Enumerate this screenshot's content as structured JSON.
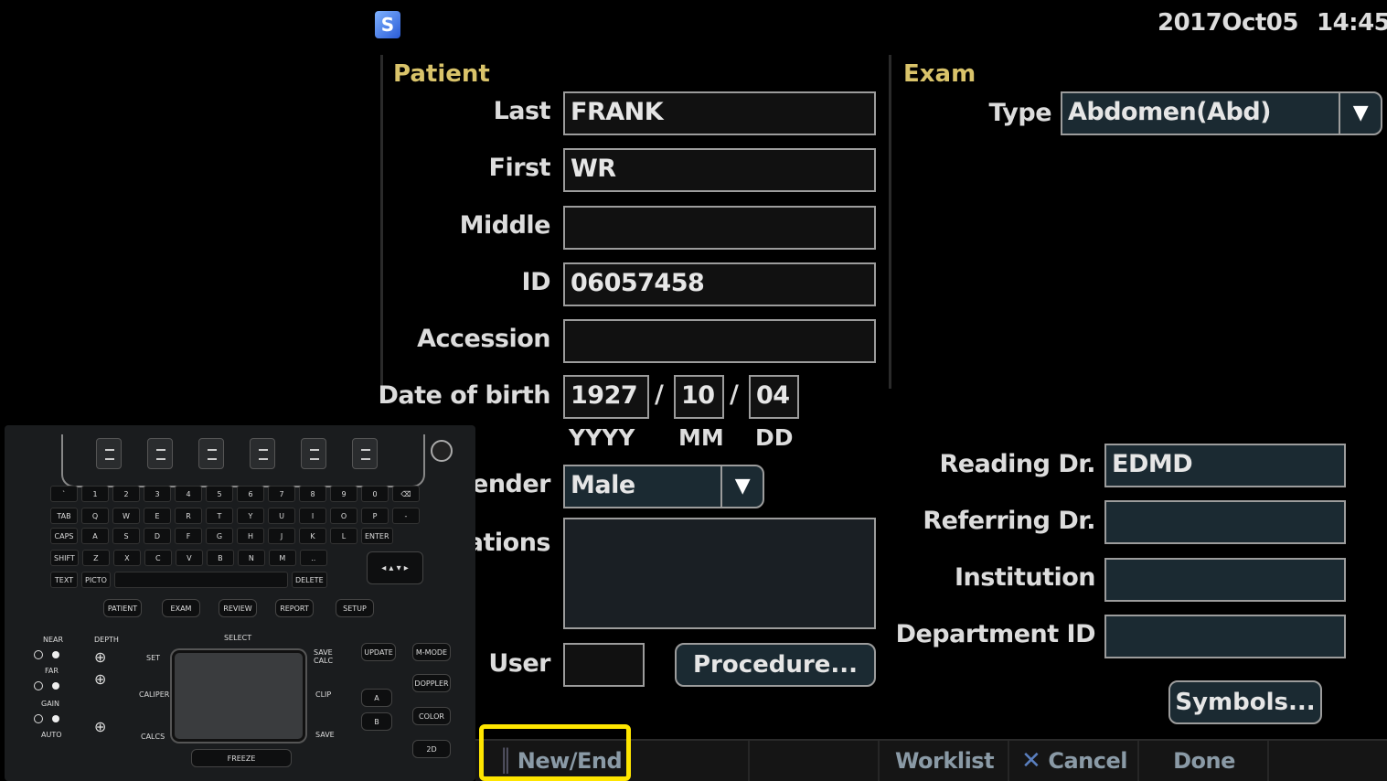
{
  "header": {
    "date": "2017Oct05",
    "time": "14:45"
  },
  "patient": {
    "title": "Patient",
    "last_label": "Last",
    "last_value": "FRANK",
    "first_label": "First",
    "first_value": "WR",
    "middle_label": "Middle",
    "middle_value": "",
    "id_label": "ID",
    "id_value": "06057458",
    "accession_label": "Accession",
    "accession_value": "",
    "dob_label": "Date of birth",
    "dob_year": "1927",
    "dob_month": "10",
    "dob_day": "04",
    "dob_sep": "/",
    "yyyy": "YYYY",
    "mm": "MM",
    "dd": "DD",
    "gender_label": "Gender",
    "gender_value": "Male",
    "indications_label": "Indications",
    "indications_value": "",
    "user_label": "User",
    "user_value": "",
    "procedure_button": "Procedure..."
  },
  "exam": {
    "title": "Exam",
    "type_label": "Type",
    "type_value": "Abdomen(Abd)",
    "reading_label": "Reading Dr.",
    "reading_value": "EDMD",
    "referring_label": "Referring Dr.",
    "referring_value": "",
    "institution_label": "Institution",
    "institution_value": "",
    "department_label": "Department ID",
    "department_value": "",
    "symbols_button": "Symbols..."
  },
  "bottombar": {
    "new_end": "New/End",
    "worklist": "Worklist",
    "cancel": "Cancel",
    "done": "Done"
  },
  "keyboard": {
    "row1": [
      "`",
      "1",
      "2",
      "3",
      "4",
      "5",
      "6",
      "7",
      "8",
      "9",
      "0",
      "⌫"
    ],
    "row2": [
      "TAB",
      "Q",
      "W",
      "E",
      "R",
      "T",
      "Y",
      "U",
      "I",
      "O",
      "P",
      "-"
    ],
    "row3": [
      "CAPS",
      "A",
      "S",
      "D",
      "F",
      "G",
      "H",
      "J",
      "K",
      "L",
      "ENTER"
    ],
    "row4": [
      "SHIFT",
      "Z",
      "X",
      "C",
      "V",
      "B",
      "N",
      "M",
      ".."
    ],
    "text": "TEXT",
    "picto": "PICTO",
    "delete": "DELETE",
    "patient": "PATIENT",
    "exam": "EXAM",
    "review": "REVIEW",
    "report": "REPORT",
    "setup": "SETUP",
    "near": "NEAR",
    "far": "FAR",
    "gain": "GAIN",
    "auto": "AUTO",
    "depth": "DEPTH",
    "select": "SELECT",
    "set": "SET",
    "caliper": "CALIPER",
    "calcs": "CALCS",
    "freeze": "FREEZE",
    "save_calc": "SAVE CALC",
    "clip": "CLIP",
    "save": "SAVE",
    "update": "UPDATE",
    "mmode": "M-MODE",
    "doppler": "DOPPLER",
    "color": "COLOR",
    "twod": "2D",
    "a": "A",
    "b": "B"
  },
  "colors": {
    "section_title": "#d9c36a",
    "highlight": "#ffe600",
    "field_border": "#9c9c9c"
  }
}
